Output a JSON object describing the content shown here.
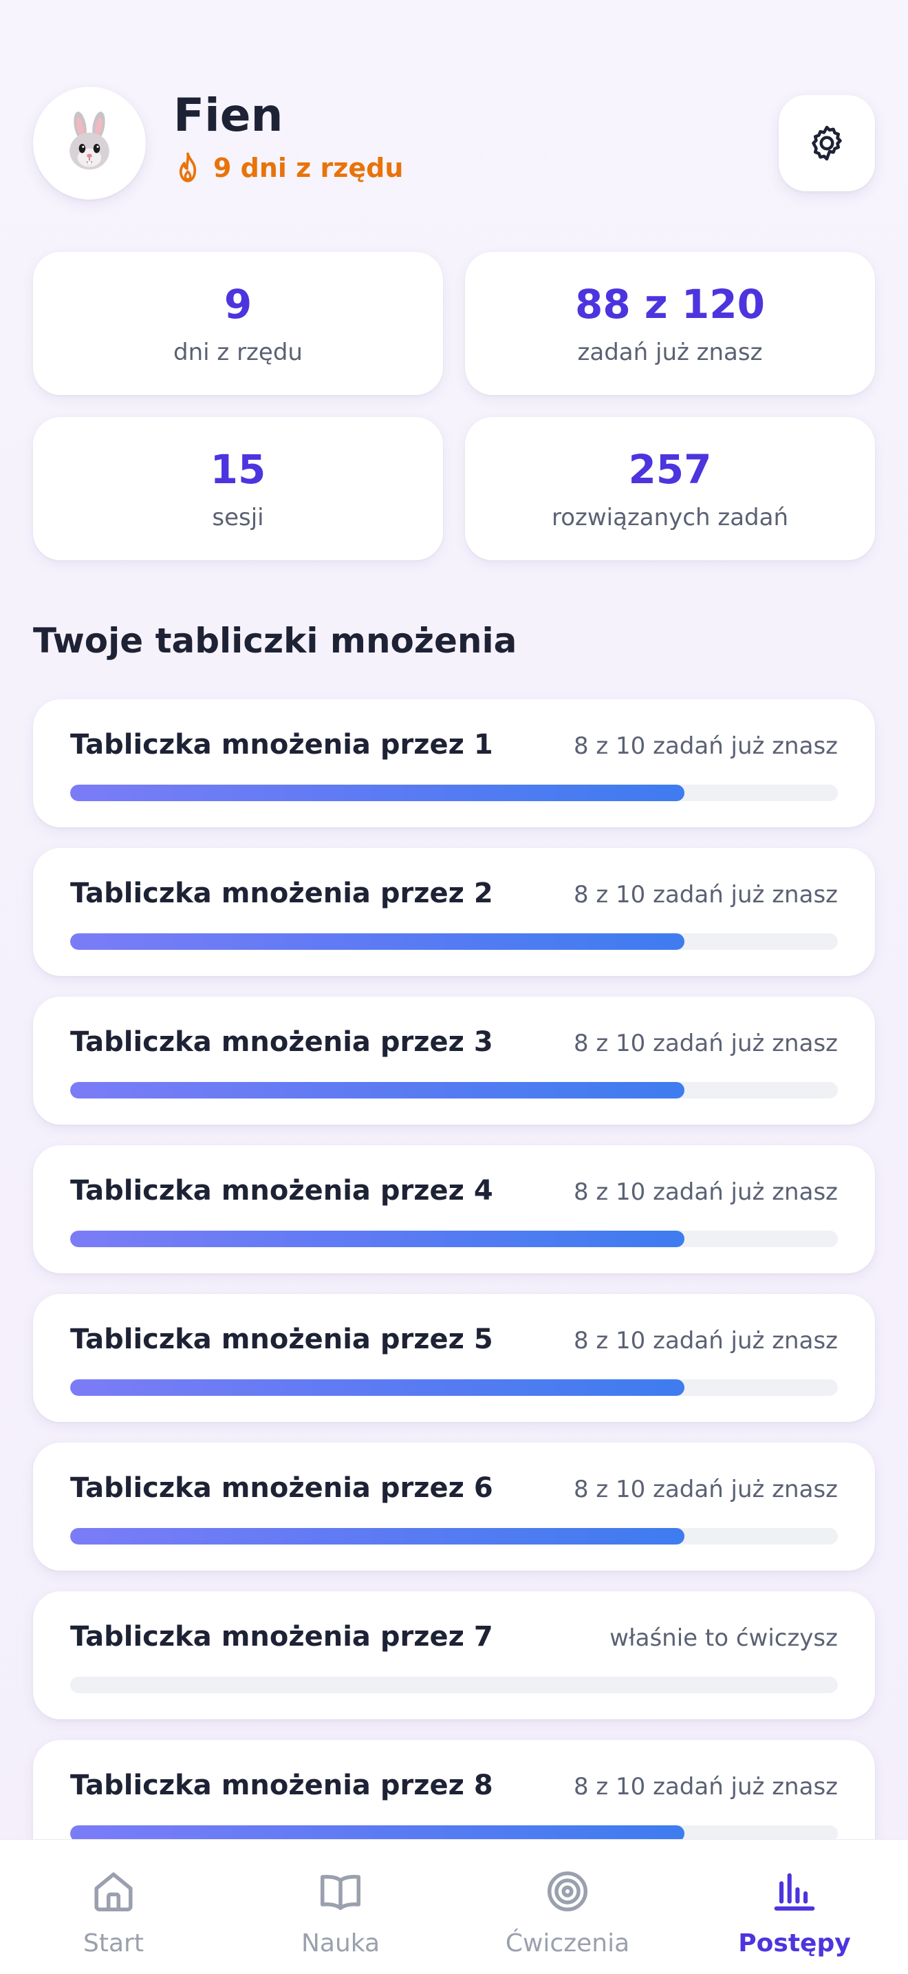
{
  "profile": {
    "name": "Fien",
    "streak_text": "9 dni z rzędu"
  },
  "stats": [
    {
      "value": "9",
      "label": "dni z rzędu"
    },
    {
      "value": "88 z 120",
      "label": "zadań już znasz"
    },
    {
      "value": "15",
      "label": "sesji"
    },
    {
      "value": "257",
      "label": "rozwiązanych zadań"
    }
  ],
  "section_title": "Twoje tabliczki mnożenia",
  "tables": [
    {
      "title": "Tabliczka mnożenia przez 1",
      "status": "8 z 10 zadań już znasz",
      "progress": 0.8
    },
    {
      "title": "Tabliczka mnożenia przez 2",
      "status": "8 z 10 zadań już znasz",
      "progress": 0.8
    },
    {
      "title": "Tabliczka mnożenia przez 3",
      "status": "8 z 10 zadań już znasz",
      "progress": 0.8
    },
    {
      "title": "Tabliczka mnożenia przez 4",
      "status": "8 z 10 zadań już znasz",
      "progress": 0.8
    },
    {
      "title": "Tabliczka mnożenia przez 5",
      "status": "8 z 10 zadań już znasz",
      "progress": 0.8
    },
    {
      "title": "Tabliczka mnożenia przez 6",
      "status": "8 z 10 zadań już znasz",
      "progress": 0.8
    },
    {
      "title": "Tabliczka mnożenia przez 7",
      "status": "właśnie to ćwiczysz",
      "progress": 0
    },
    {
      "title": "Tabliczka mnożenia przez 8",
      "status": "8 z 10 zadań już znasz",
      "progress": 0.8
    }
  ],
  "nav": [
    {
      "label": "Start",
      "icon": "home-icon",
      "active": false
    },
    {
      "label": "Nauka",
      "icon": "book-icon",
      "active": false
    },
    {
      "label": "Ćwiczenia",
      "icon": "target-icon",
      "active": false
    },
    {
      "label": "Postępy",
      "icon": "bar-chart-icon",
      "active": true
    }
  ],
  "colors": {
    "accent": "#4c35de",
    "streak": "#e8730a",
    "text": "#1e2235",
    "muted": "#5b6173",
    "nav_inactive": "#9aa0ad"
  }
}
